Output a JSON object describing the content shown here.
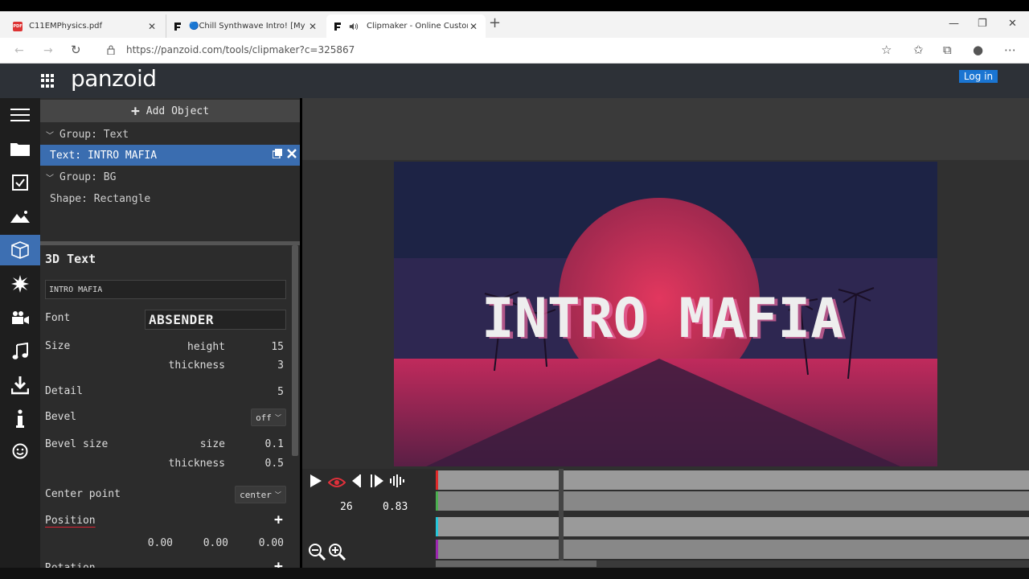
{
  "browser": {
    "tabs": [
      {
        "label": "C11EMPhysics.pdf",
        "icon": "pdf-icon"
      },
      {
        "label": "🔵Chill Synthwave Intro! [My Sc",
        "icon": "panzoid-icon"
      },
      {
        "label": "Clipmaker - Online Custom",
        "icon": "panzoid-icon",
        "active": true
      }
    ],
    "url": "https://panzoid.com/tools/clipmaker?c=325867"
  },
  "header": {
    "logo": "panzoid",
    "login_label": "Log in"
  },
  "object_panel": {
    "add_object_label": "Add Object",
    "tree": [
      {
        "label": "Group: Text",
        "type": "group"
      },
      {
        "label": "Text: INTRO MAFIA",
        "type": "item",
        "selected": true
      },
      {
        "label": "Group: BG",
        "type": "group"
      },
      {
        "label": "Shape: Rectangle",
        "type": "item"
      }
    ]
  },
  "properties": {
    "title": "3D Text",
    "text_value": "INTRO MAFIA",
    "font_label": "Font",
    "font_value": "ABSENDER",
    "size_label": "Size",
    "height_label": "height",
    "height_value": "15",
    "thickness_label": "thickness",
    "thickness_value": "3",
    "detail_label": "Detail",
    "detail_value": "5",
    "bevel_label": "Bevel",
    "bevel_value": "off",
    "bevel_size_label": "Bevel size",
    "bevel_size_sub": "size",
    "bevel_size_value": "0.1",
    "bevel_thickness_label": "thickness",
    "bevel_thickness_value": "0.5",
    "center_label": "Center point",
    "center_value": "center",
    "position_label": "Position",
    "position_x": "0.00",
    "position_y": "0.00",
    "position_z": "0.00",
    "rotation_label": "Rotation"
  },
  "preview": {
    "title_text": "INTRO MAFIA"
  },
  "timeline": {
    "frame": "26",
    "time": "0.83",
    "track_colors": [
      "#e02b2b",
      "#4caf50",
      "#26c6da",
      "#9c27b0"
    ]
  }
}
